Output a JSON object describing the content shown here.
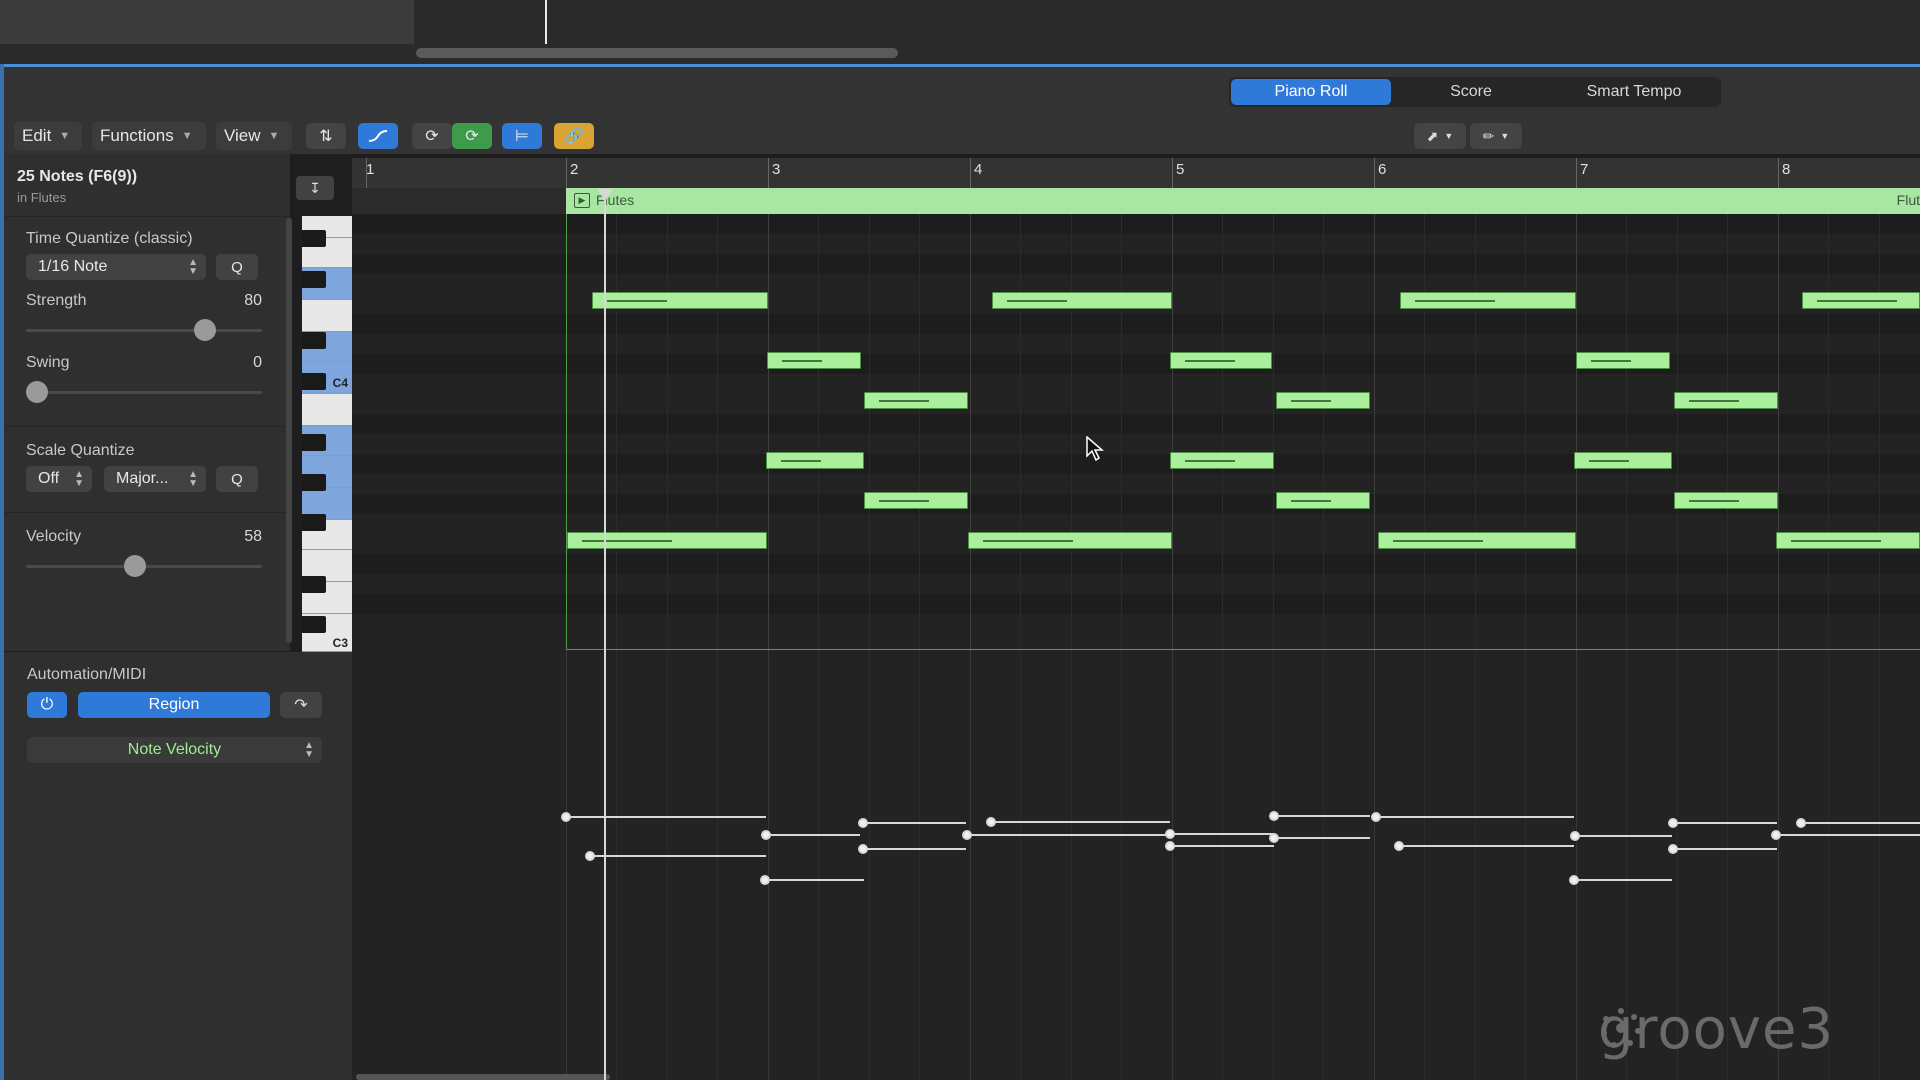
{
  "view_tabs": [
    "Piano Roll",
    "Score",
    "Smart Tempo"
  ],
  "active_tab": "Piano Roll",
  "menus": {
    "edit": "Edit",
    "functions": "Functions",
    "view": "View"
  },
  "inspector": {
    "title": "25 Notes (F6(9))",
    "subtitle": "in Flutes",
    "time_quantize": {
      "label": "Time Quantize (classic)",
      "value": "1/16 Note",
      "q": "Q"
    },
    "strength": {
      "label": "Strength",
      "value": "80"
    },
    "swing": {
      "label": "Swing",
      "value": "0"
    },
    "scale_quantize": {
      "label": "Scale Quantize",
      "value": "Off",
      "scale": "Major...",
      "q": "Q"
    },
    "velocity": {
      "label": "Velocity",
      "value": "58"
    }
  },
  "keyboard": {
    "c4": "C4",
    "c3": "C3"
  },
  "ruler": {
    "bars": [
      "1",
      "2",
      "3",
      "4",
      "5",
      "6",
      "7",
      "8"
    ]
  },
  "region": {
    "name": "Flutes",
    "name_cut": "Flut"
  },
  "automation": {
    "label": "Automation/MIDI",
    "region_button": "Region",
    "parameter": "Note Velocity"
  },
  "watermark": "groove3",
  "colors": {
    "accent_blue": "#2f7ad8",
    "note_green": "#a9ef9c",
    "region_green": "#a8e6a4",
    "yellow_button": "#d8a535"
  },
  "icons": [
    "chevron-down-icon",
    "collapse-icon",
    "midi-in-icon",
    "loop-icon",
    "catch-icon",
    "link-icon",
    "pointer-tool-icon",
    "pencil-tool-icon",
    "power-icon",
    "redo-arrow-icon",
    "play-icon",
    "mouse-cursor-icon"
  ]
}
